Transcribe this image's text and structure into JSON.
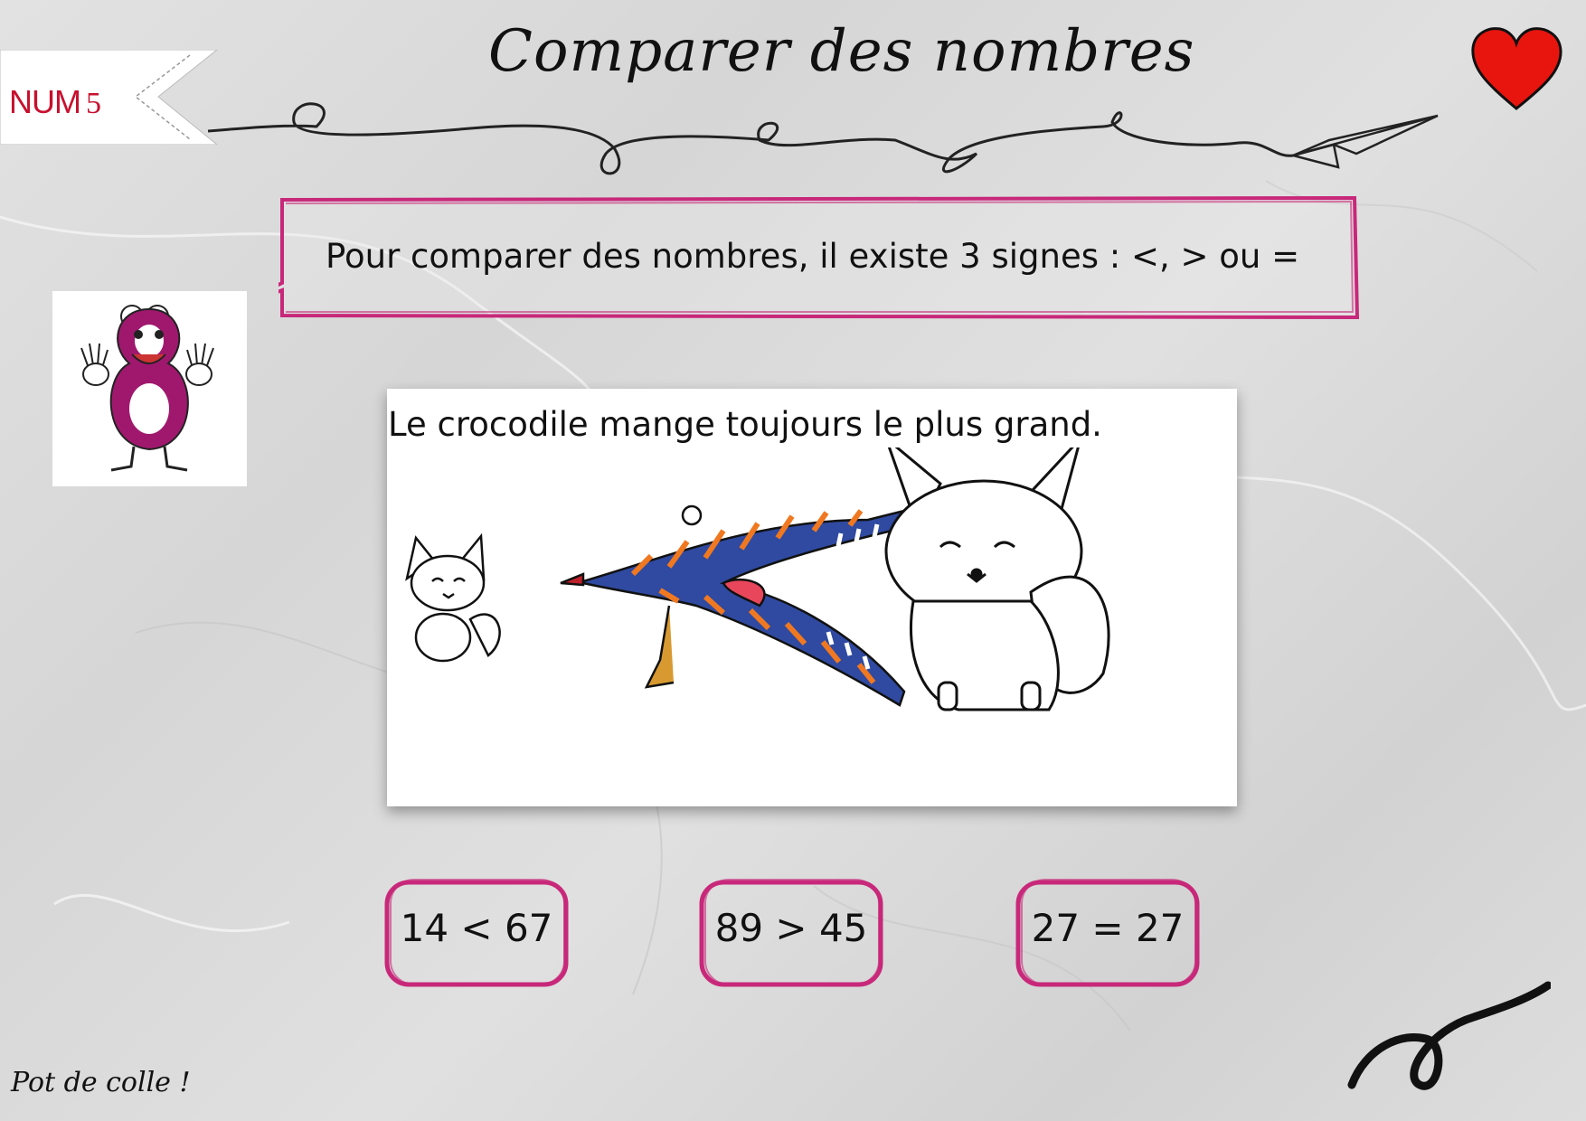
{
  "header": {
    "tag_prefix": "NUM",
    "tag_number": "5",
    "title": "Comparer des nombres"
  },
  "bubble": {
    "text": "Pour comparer des nombres, il existe 3 signes : <, > ou ="
  },
  "card": {
    "caption": "Le crocodile mange toujours le plus grand."
  },
  "comparisons": [
    {
      "text": "14 < 67"
    },
    {
      "text": "89 > 45"
    },
    {
      "text": "27 = 27"
    }
  ],
  "footer": {
    "signature": "Pot de colle !"
  },
  "icons": {
    "heart": "heart-icon",
    "paper_plane": "paper-plane-icon",
    "mascot": "number-eight-mascot"
  },
  "colors": {
    "accent_pink": "#c8287a",
    "tag_red": "#c8102e",
    "heart_red": "#e8150f"
  }
}
